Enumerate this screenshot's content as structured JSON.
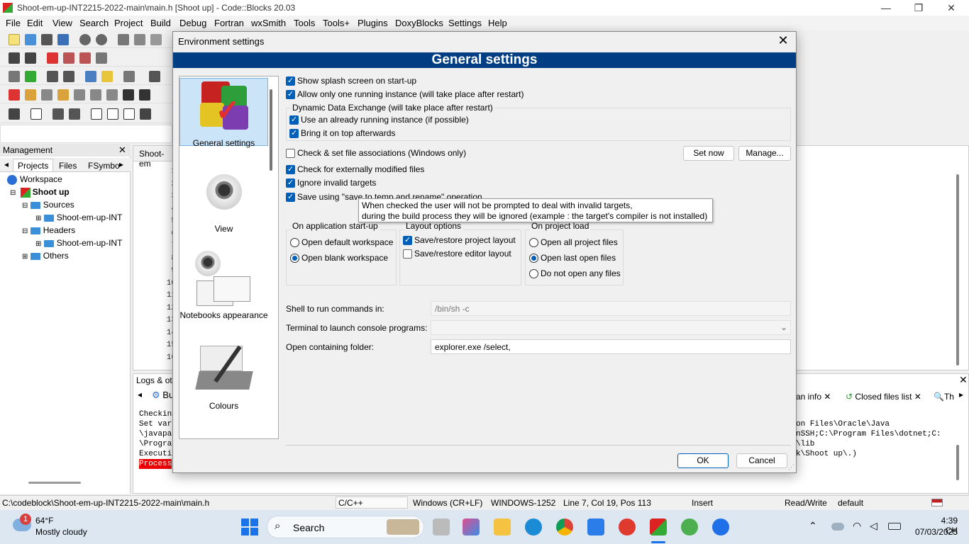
{
  "window": {
    "title": "Shoot-em-up-INT2215-2022-main\\main.h [Shoot up] - Code::Blocks 20.03",
    "minimize": "—",
    "maximize": "❐",
    "close": "✕"
  },
  "menu": [
    "File",
    "Edit",
    "View",
    "Search",
    "Project",
    "Build",
    "Debug",
    "Fortran",
    "wxSmith",
    "Tools",
    "Tools+",
    "Plugins",
    "DoxyBlocks",
    "Settings",
    "Help"
  ],
  "management": {
    "title": "Management",
    "close": "✕",
    "tabs": [
      "Projects",
      "Files",
      "FSymbo"
    ],
    "tree": {
      "workspace": "Workspace",
      "project": "Shoot up",
      "sources": "Sources",
      "sources_child": "Shoot-em-up-INT",
      "headers": "Headers",
      "headers_child": "Shoot-em-up-INT",
      "others": "Others"
    }
  },
  "editor": {
    "tab": "Shoot-em",
    "line_numbers": [
      "1",
      "2",
      "3",
      "4",
      "5",
      "6",
      "7",
      "8",
      "9",
      "10",
      "11",
      "12",
      "13",
      "14",
      "15",
      "16"
    ]
  },
  "logs": {
    "title": "Logs & oth",
    "tab_build": "Bu",
    "tab_scan": "an info",
    "tab_closed": "Closed files list",
    "tab_th": "Th",
    "lines_left": [
      "Checkin",
      "Set var",
      "\\javapa",
      "\\Progra",
      "Executi",
      "Process"
    ],
    "lines_right": [
      "on Files\\Oracle\\Java",
      "nSSH;C:\\Program Files\\dotnet;C:",
      "\\lib",
      "k\\Shoot up\\.)"
    ]
  },
  "dialog": {
    "title": "Environment settings",
    "close": "✕",
    "banner": "General settings",
    "sidebar": [
      {
        "label": "General settings",
        "selected": true
      },
      {
        "label": "View",
        "selected": false
      },
      {
        "label": "Notebooks appearance",
        "selected": false
      },
      {
        "label": "Colours",
        "selected": false
      }
    ],
    "checks": {
      "splash": {
        "label": "Show splash screen on start-up",
        "checked": true
      },
      "one_instance": {
        "label": "Allow only one running instance (will take place after restart)",
        "checked": true
      },
      "dde_group": "Dynamic Data Exchange (will take place after restart)",
      "use_running": {
        "label": "Use an already running instance (if possible)",
        "checked": true
      },
      "bring_top": {
        "label": "Bring it on top afterwards",
        "checked": true
      },
      "file_assoc": {
        "label": "Check & set file associations (Windows only)",
        "checked": false
      },
      "ext_modified": {
        "label": "Check for externally modified files",
        "checked": true
      },
      "ignore_invalid": {
        "label": "Ignore invalid targets",
        "checked": true
      },
      "save_temp": {
        "label": "Save using \"save to temp and rename\" operation",
        "checked": true
      }
    },
    "buttons": {
      "set_now": "Set now",
      "manage": "Manage...",
      "ok": "OK",
      "cancel": "Cancel"
    },
    "tooltip": {
      "line1": "When checked the user will not be prompted to deal with invalid targets,",
      "line2": "during the build process they will be ignored (example : the target's compiler is not installed)"
    },
    "startup": {
      "title": "On application start-up",
      "options": [
        "Open default workspace",
        "Open blank workspace"
      ],
      "selected": 1
    },
    "layout": {
      "title": "Layout options",
      "project_layout": {
        "label": "Save/restore project layout",
        "checked": true
      },
      "editor_layout": {
        "label": "Save/restore editor layout",
        "checked": false
      }
    },
    "project_load": {
      "title": "On project load",
      "options": [
        "Open all project files",
        "Open last open files",
        "Do not open any files"
      ],
      "selected": 1
    },
    "shell": {
      "label": "Shell to run commands in:",
      "value": "/bin/sh -c"
    },
    "terminal": {
      "label": "Terminal to launch console programs:",
      "value": ""
    },
    "folder": {
      "label": "Open containing folder:",
      "value": "explorer.exe /select,"
    }
  },
  "status": {
    "path": "C:\\codeblock\\Shoot-em-up-INT2215-2022-main\\main.h",
    "language": "C/C++",
    "eol": "Windows (CR+LF)",
    "encoding": "WINDOWS-1252",
    "position": "Line 7, Col 19, Pos 113",
    "mode": "Insert",
    "access": "Read/Write",
    "profile": "default"
  },
  "taskbar": {
    "weather_temp": "64°F",
    "weather_desc": "Mostly cloudy",
    "weather_badge": "1",
    "search": "Search",
    "time": "4:39 CH",
    "date": "07/03/2025"
  }
}
